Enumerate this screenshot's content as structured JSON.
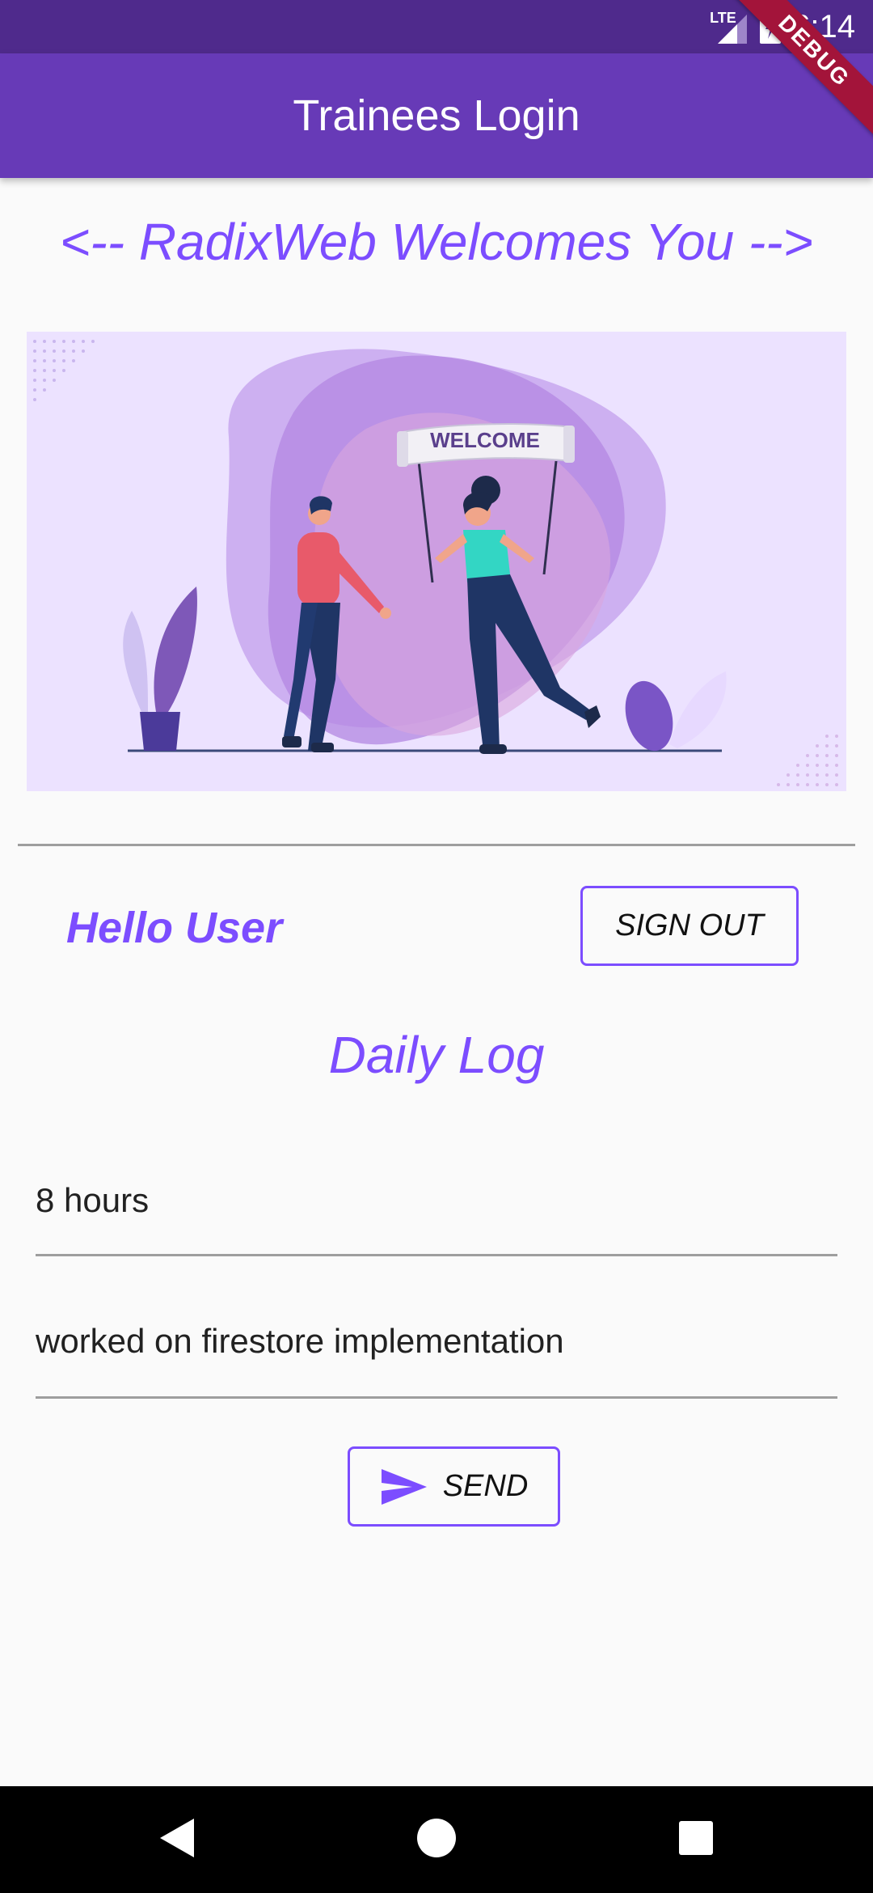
{
  "status_bar": {
    "network": "LTE",
    "time": "6:14"
  },
  "app_bar": {
    "title": "Trainees Login"
  },
  "debug_banner": "DEBUG",
  "welcome_text": "<-- RadixWeb Welcomes You -->",
  "hero": {
    "banner_text": "WELCOME"
  },
  "user": {
    "greeting": "Hello User",
    "sign_out_label": "SIGN OUT"
  },
  "daily_log": {
    "title": "Daily Log",
    "hours_value": "8 hours",
    "description_value": "worked on firestore implementation",
    "send_label": "SEND"
  },
  "colors": {
    "primary": "#673ab7",
    "status_bar": "#4f2a8c",
    "accent": "#7c4dff"
  }
}
